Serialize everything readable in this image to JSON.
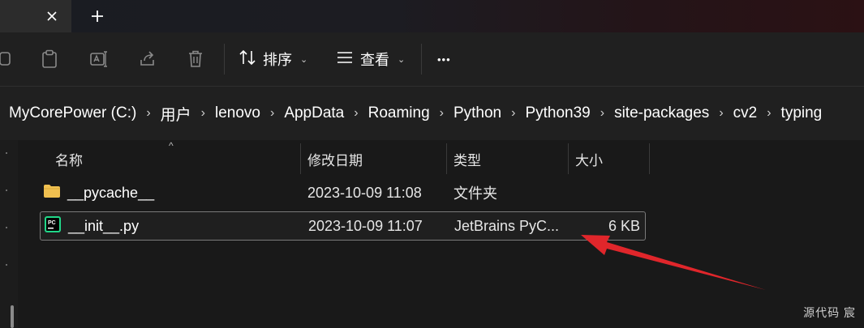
{
  "tabs": {
    "close_icon": "close-icon",
    "new_tab_label": "+"
  },
  "toolbar": {
    "icons": [
      "copy-icon",
      "paste-icon",
      "rename-icon",
      "share-icon",
      "delete-icon"
    ],
    "sort_label": "排序",
    "view_label": "查看",
    "more_label": "•••"
  },
  "breadcrumb": {
    "items": [
      "MyCorePower (C:)",
      "用户",
      "lenovo",
      "AppData",
      "Roaming",
      "Python",
      "Python39",
      "site-packages",
      "cv2",
      "typing"
    ],
    "separator": "›"
  },
  "columns": {
    "name": "名称",
    "date": "修改日期",
    "type": "类型",
    "size": "大小"
  },
  "files": [
    {
      "name": "__pycache__",
      "date": "2023-10-09 11:08",
      "type": "文件夹",
      "size": "",
      "icon": "folder-icon"
    },
    {
      "name": "__init__.py",
      "date": "2023-10-09 11:07",
      "type": "JetBrains PyC...",
      "size": "6 KB",
      "icon": "pycharm-file-icon",
      "selected": true
    }
  ],
  "watermark": "源代码  宸",
  "colors": {
    "accent_arrow": "#e0262b",
    "folder": "#f0c050",
    "selection_border": "#7a7a7a"
  }
}
